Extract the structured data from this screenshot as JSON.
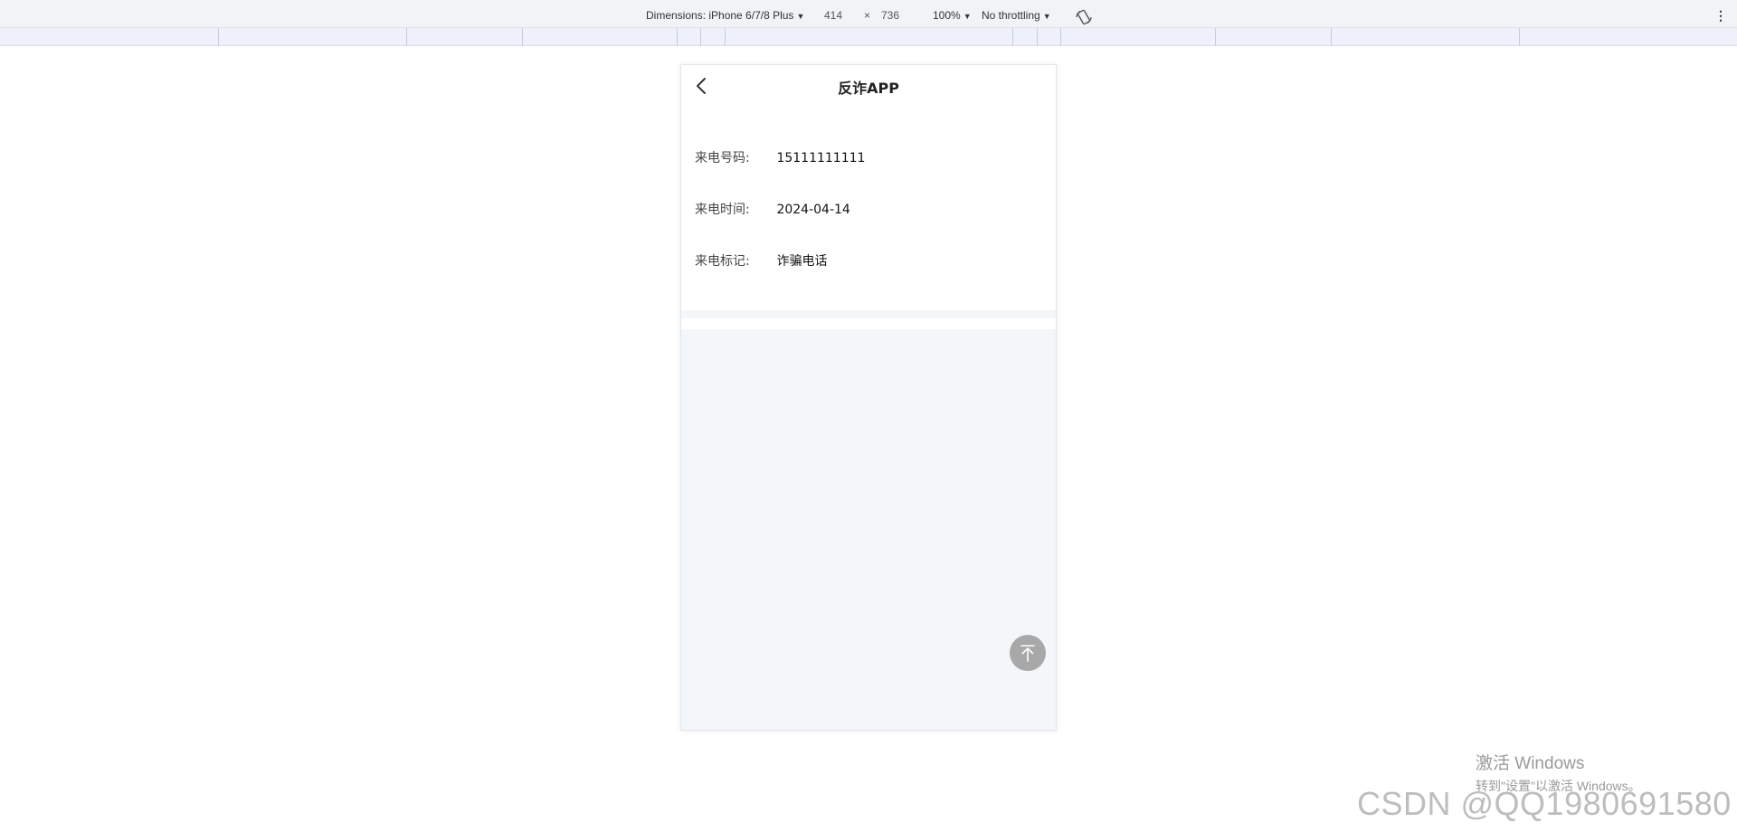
{
  "devtools": {
    "dimensions_label": "Dimensions: iPhone 6/7/8 Plus",
    "width": "414",
    "times": "×",
    "height": "736",
    "zoom": "100%",
    "throttle": "No throttling",
    "more": "⋮",
    "rotate_icon": "rotate-icon"
  },
  "app": {
    "title": "反诈APP",
    "back_icon": "back-arrow-icon",
    "rows": [
      {
        "label": "来电号码:",
        "value": "15111111111"
      },
      {
        "label": "来电时间:",
        "value": "2024-04-14"
      },
      {
        "label": "来电标记:",
        "value": "诈骗电话"
      }
    ],
    "back_to_top_icon": "back-to-top-icon"
  },
  "watermarks": {
    "windows_line1": "激活 Windows",
    "windows_line2": "转到\"设置\"以激活 Windows。",
    "csdn": "CSDN @QQ1980691580"
  },
  "colors": {
    "page_bg": "#f4f7fa",
    "card_bg": "#ffffff",
    "fab": "#a8a8a8"
  }
}
